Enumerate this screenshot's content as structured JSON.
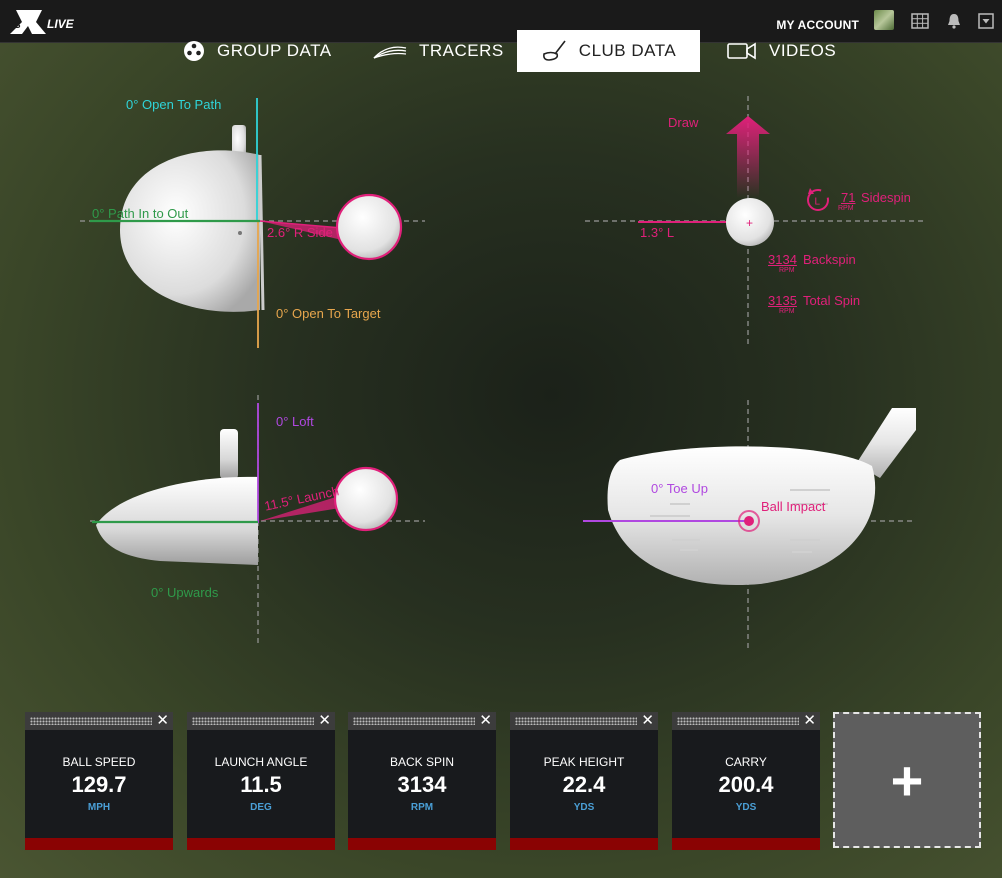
{
  "header": {
    "logo_text": "FSX LIVE",
    "account_label": "MY ACCOUNT"
  },
  "tabs": [
    {
      "label": "GROUP DATA",
      "icon": "group-icon",
      "active": false
    },
    {
      "label": "TRACERS",
      "icon": "tracer-icon",
      "active": false
    },
    {
      "label": "CLUB DATA",
      "icon": "club-icon",
      "active": true
    },
    {
      "label": "VIDEOS",
      "icon": "video-icon",
      "active": false
    }
  ],
  "top_view": {
    "face_to_path": "0° Open To Path",
    "club_path": "0° Path In to Out",
    "side": "2.6° R Side",
    "face_to_target": "0° Open To Target"
  },
  "spin_view": {
    "direction": "Draw",
    "launch_dir": "1.3° L",
    "sidespin_value": "71",
    "sidespin_label": "Sidespin",
    "sidespin_unit": "RPM",
    "sidespin_badge": "L",
    "backspin_value": "3134",
    "backspin_label": "Backspin",
    "backspin_unit": "RPM",
    "totalspin_value": "3135",
    "totalspin_label": "Total Spin",
    "totalspin_unit": "RPM"
  },
  "side_view": {
    "loft": "0° Loft",
    "launch": "11.5° Launch",
    "attack": "0° Upwards"
  },
  "face_view": {
    "toe": "0° Toe Up",
    "impact": "Ball Impact"
  },
  "metrics": [
    {
      "name": "BALL SPEED",
      "value": "129.7",
      "unit": "MPH"
    },
    {
      "name": "LAUNCH ANGLE",
      "value": "11.5",
      "unit": "DEG"
    },
    {
      "name": "BACK SPIN",
      "value": "3134",
      "unit": "RPM"
    },
    {
      "name": "PEAK HEIGHT",
      "value": "22.4",
      "unit": "YDS"
    },
    {
      "name": "CARRY",
      "value": "200.4",
      "unit": "YDS"
    }
  ],
  "add_tile": {
    "label": "+"
  },
  "colors": {
    "accent_pink": "#e0207a",
    "path_green": "#2f9a4a",
    "open_cyan": "#2fd4d8",
    "target_orange": "#e7a64d",
    "loft_purple": "#b048e0",
    "unit_blue": "#4a9fd6",
    "card_bar": "#8a0303"
  }
}
